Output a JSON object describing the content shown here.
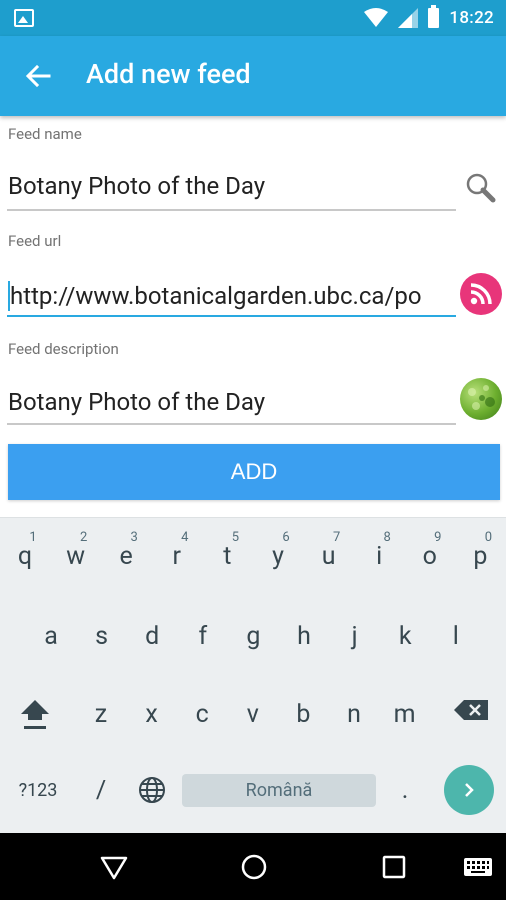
{
  "status_bar": {
    "time": "18:22",
    "icons": [
      "image-notification-icon",
      "wifi-icon",
      "cell-signal-icon",
      "battery-icon"
    ]
  },
  "app_bar": {
    "title": "Add new feed",
    "back_icon": "arrow-back-icon"
  },
  "form": {
    "feed_name": {
      "label": "Feed name",
      "value": "Botany Photo of the Day",
      "icon": "search-icon"
    },
    "feed_url": {
      "label": "Feed url",
      "value": "http://www.botanicalgarden.ubc.ca/po",
      "icon": "rss-icon"
    },
    "feed_description": {
      "label": "Feed description",
      "value": "Botany Photo of the Day",
      "icon": "feed-thumbnail-icon"
    },
    "add_button": "ADD"
  },
  "keyboard": {
    "row1": [
      {
        "k": "q",
        "h": "1"
      },
      {
        "k": "w",
        "h": "2"
      },
      {
        "k": "e",
        "h": "3"
      },
      {
        "k": "r",
        "h": "4"
      },
      {
        "k": "t",
        "h": "5"
      },
      {
        "k": "y",
        "h": "6"
      },
      {
        "k": "u",
        "h": "7"
      },
      {
        "k": "i",
        "h": "8"
      },
      {
        "k": "o",
        "h": "9"
      },
      {
        "k": "p",
        "h": "0"
      }
    ],
    "row2": [
      "a",
      "s",
      "d",
      "f",
      "g",
      "h",
      "j",
      "k",
      "l"
    ],
    "row3": [
      "z",
      "x",
      "c",
      "v",
      "b",
      "n",
      "m"
    ],
    "symbols_key": "?123",
    "slash_key": "/",
    "space_label": "Română",
    "period_key": "."
  },
  "nav_bar": {
    "buttons": [
      "back-triangle-icon",
      "home-circle-icon",
      "recents-square-icon",
      "keyboard-icon"
    ]
  },
  "colors": {
    "status_bar": "#1e9ecd",
    "app_bar": "#29a9e1",
    "add_button": "#3b9ff0",
    "enter_key": "#4db6ac",
    "rss": "#e8357a"
  }
}
